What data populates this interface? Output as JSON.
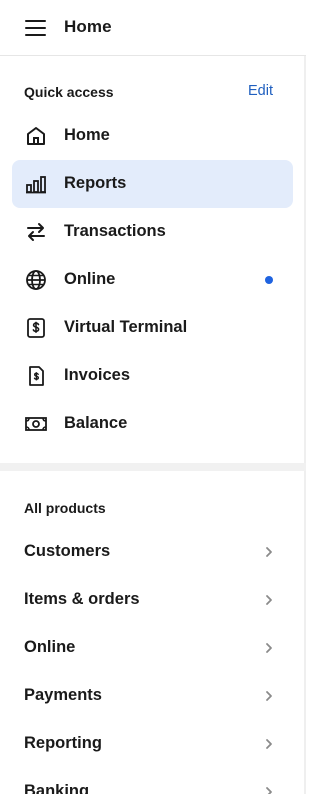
{
  "header": {
    "title": "Home",
    "menu_icon": "hamburger-menu-icon"
  },
  "quick_access": {
    "heading": "Quick access",
    "edit_label": "Edit",
    "accent_color": "#1f63e0",
    "selected_bg": "#e3ecfb",
    "items": [
      {
        "label": "Home",
        "icon": "home-icon",
        "selected": false,
        "dot": false
      },
      {
        "label": "Reports",
        "icon": "reports-bar-chart-icon",
        "selected": true,
        "dot": false
      },
      {
        "label": "Transactions",
        "icon": "transfer-arrows-icon",
        "selected": false,
        "dot": false
      },
      {
        "label": "Online",
        "icon": "globe-icon",
        "selected": false,
        "dot": true
      },
      {
        "label": "Virtual Terminal",
        "icon": "dollar-terminal-icon",
        "selected": false,
        "dot": false
      },
      {
        "label": "Invoices",
        "icon": "invoice-document-icon",
        "selected": false,
        "dot": false
      },
      {
        "label": "Balance",
        "icon": "banknote-icon",
        "selected": false,
        "dot": false
      }
    ]
  },
  "all_products": {
    "heading": "All products",
    "items": [
      {
        "label": "Customers"
      },
      {
        "label": "Items & orders"
      },
      {
        "label": "Online"
      },
      {
        "label": "Payments"
      },
      {
        "label": "Reporting"
      },
      {
        "label": "Banking"
      }
    ]
  }
}
